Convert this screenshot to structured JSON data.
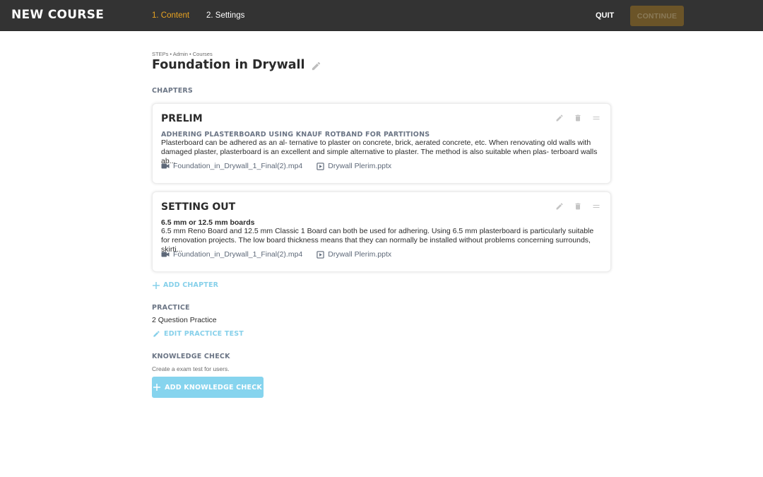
{
  "header": {
    "brand": "NEW COURSE",
    "steps": [
      {
        "label": "1. Content",
        "active": true
      },
      {
        "label": "2. Settings",
        "active": false
      }
    ],
    "quit_label": "QUIT",
    "continue_label": "CONTINUE"
  },
  "breadcrumb": "STEPs • Admin • Courses",
  "course_title": "Foundation in Drywall",
  "chapters_label": "CHAPTERS",
  "chapters": [
    {
      "title": "PRELIM",
      "subtitle": "ADHERING PLASTERBOARD USING KNAUF ROTBAND FOR PARTITIONS",
      "description": "Plasterboard can be adhered as an al- ternative to plaster on concrete, brick, aerated concrete, etc. When renovating old walls with damaged plaster, plasterboard is an excellent and simple alternative to plaster. The method is also suitable when plas- terboard walls ab...",
      "files": [
        {
          "icon": "video-camera-icon",
          "name": "Foundation_in_Drywall_1_Final(2).mp4"
        },
        {
          "icon": "presentation-play-icon",
          "name": "Drywall Plerim.pptx"
        }
      ]
    },
    {
      "title": "SETTING OUT",
      "subtitle": "6.5 mm or 12.5 mm boards",
      "description": "6.5 mm Reno Board and 12.5 mm Classic 1 Board can both be used for adhering. Using 6.5 mm plasterboard is particularly suitable for renovation projects. The low board thickness means that they can normally be installed without problems concerning surrounds, skirti...",
      "files": [
        {
          "icon": "video-camera-icon",
          "name": "Foundation_in_Drywall_1_Final(2).mp4"
        },
        {
          "icon": "presentation-play-icon",
          "name": "Drywall Plerim.pptx"
        }
      ]
    }
  ],
  "add_chapter_label": "ADD CHAPTER",
  "practice": {
    "label": "PRACTICE",
    "value": "2 Question Practice",
    "edit_label": "EDIT PRACTICE TEST"
  },
  "knowledge_check": {
    "label": "KNOWLEDGE CHECK",
    "hint": "Create a exam test for users.",
    "add_label": "ADD KNOWLEDGE CHECK"
  },
  "colors": {
    "topbar": "#333333",
    "active_step": "#e8a321",
    "continue_bg": "#6b5428",
    "accent_link": "#86d0ea",
    "section_label": "#6b7585"
  }
}
